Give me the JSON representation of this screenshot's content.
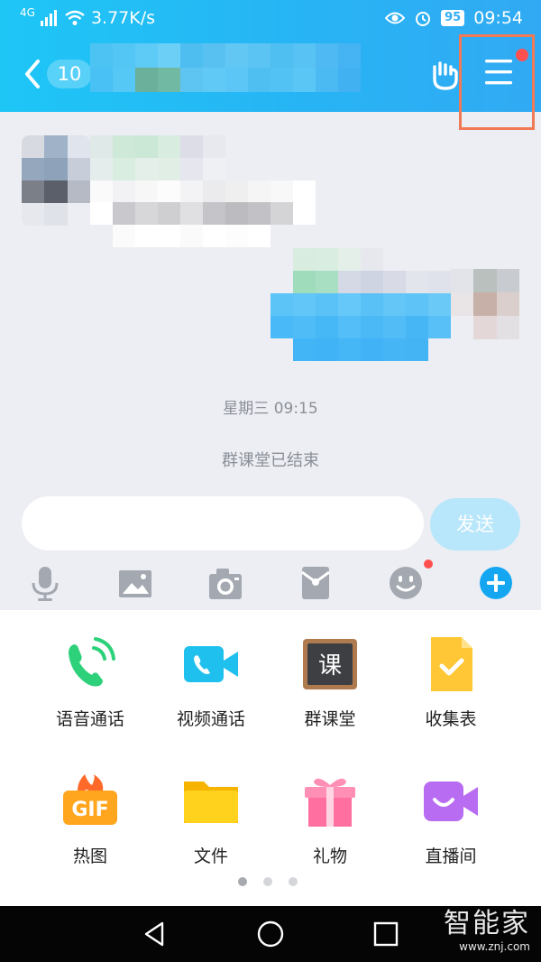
{
  "status_bar": {
    "network": "4G",
    "speed": "3.77K/s",
    "battery": "95",
    "time": "09:54"
  },
  "header": {
    "unread_count": "10",
    "icons": [
      "back-chevron-icon",
      "hand-gesture-icon",
      "menu-icon"
    ]
  },
  "chat": {
    "timestamp": "星期三 09:15",
    "system_notice": "群课堂已结束"
  },
  "composer": {
    "input_value": "",
    "send_label": "发送"
  },
  "toolbar": {
    "icons": [
      "microphone-icon",
      "image-icon",
      "camera-icon",
      "red-envelope-icon",
      "emoji-icon",
      "plus-icon"
    ]
  },
  "apps": [
    {
      "label": "语音通话",
      "icon": "phone-icon"
    },
    {
      "label": "视频通话",
      "icon": "video-call-icon"
    },
    {
      "label": "群课堂",
      "icon": "classroom-icon",
      "icon_text": "课"
    },
    {
      "label": "收集表",
      "icon": "collection-form-icon"
    },
    {
      "label": "热图",
      "icon": "gif-icon",
      "icon_text": "GIF"
    },
    {
      "label": "文件",
      "icon": "folder-icon"
    },
    {
      "label": "礼物",
      "icon": "gift-icon"
    },
    {
      "label": "直播间",
      "icon": "live-room-icon"
    }
  ],
  "pager": {
    "pages": 3,
    "active": 1
  },
  "watermark": {
    "brand": "智能家",
    "url": "www.znj.com"
  },
  "colors": {
    "accent": "#27b4f4",
    "dot": "#ff4f4f",
    "highlight": "#ef7a55"
  }
}
